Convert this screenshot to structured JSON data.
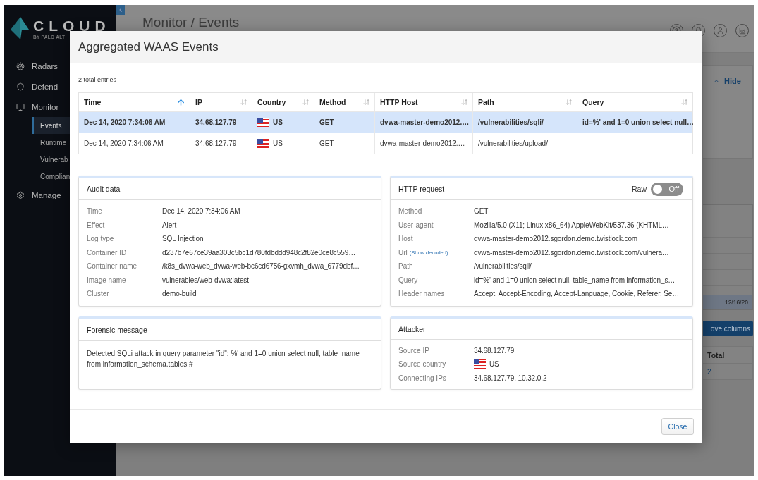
{
  "sidebar": {
    "logo": {
      "name": "CLOUD",
      "subtitle": "BY PALO ALT"
    },
    "items": [
      {
        "label": "Radars",
        "selected": false
      },
      {
        "label": "Defend",
        "selected": false
      },
      {
        "label": "Monitor",
        "selected": false,
        "children": [
          {
            "label": "Events",
            "selected": true
          },
          {
            "label": "Runtime",
            "selected": false
          },
          {
            "label": "Vulnerab",
            "selected": false
          },
          {
            "label": "Complian",
            "selected": false
          }
        ]
      },
      {
        "label": "Manage",
        "selected": false
      }
    ]
  },
  "header": {
    "title": "Monitor / Events"
  },
  "background": {
    "hide_label": "Hide",
    "date": "12/16/20",
    "button": "ove columns",
    "table_header": "Total",
    "table_value": "2"
  },
  "modal": {
    "title": "Aggregated WAAS Events",
    "count": "2 total entries",
    "table": {
      "columns": [
        {
          "label": "Time",
          "sorted": true
        },
        {
          "label": "IP",
          "sorted": false
        },
        {
          "label": "Country",
          "sorted": false
        },
        {
          "label": "Method",
          "sorted": false
        },
        {
          "label": "HTTP Host",
          "sorted": false
        },
        {
          "label": "Path",
          "sorted": false
        },
        {
          "label": "Query",
          "sorted": false
        }
      ],
      "rows": [
        {
          "selected": true,
          "time": "Dec 14, 2020 7:34:06 AM",
          "ip": "34.68.127.79",
          "country": "US",
          "method": "GET",
          "host": "dvwa-master-demo2012.…",
          "path": "/vulnerabilities/sqli/",
          "query": "id=%' and 1=0 union select null…"
        },
        {
          "selected": false,
          "time": "Dec 14, 2020 7:34:06 AM",
          "ip": "34.68.127.79",
          "country": "US",
          "method": "GET",
          "host": "dvwa-master-demo2012.…",
          "path": "/vulnerabilities/upload/"
        }
      ]
    },
    "audit": {
      "title": "Audit data",
      "fields": [
        {
          "label": "Time",
          "value": "Dec 14, 2020 7:34:06 AM"
        },
        {
          "label": "Effect",
          "value": "Alert"
        },
        {
          "label": "Log type",
          "value": "SQL Injection"
        },
        {
          "label": "Container ID",
          "value": "d237b7e67ce39aa303c5bc1d780fdbddd948c2f82e0ce8c559…"
        },
        {
          "label": "Container name",
          "value": "/k8s_dvwa-web_dvwa-web-bc6cd6756-gxvmh_dvwa_6779dbf…"
        },
        {
          "label": "Image name",
          "value": "vulnerables/web-dvwa:latest"
        },
        {
          "label": "Cluster",
          "value": "demo-build"
        }
      ]
    },
    "http": {
      "title": "HTTP request",
      "raw_label": "Raw",
      "toggle": {
        "on": false,
        "label": "Off"
      },
      "fields": [
        {
          "label": "Method",
          "value": "GET"
        },
        {
          "label": "User-agent",
          "value": "Mozilla/5.0 (X11; Linux x86_64) AppleWebKit/537.36 (KHTML…"
        },
        {
          "label": "Host",
          "value": "dvwa-master-demo2012.sgordon.demo.twistlock.com"
        },
        {
          "label": "Url",
          "hint": "(Show decoded)",
          "value": "dvwa-master-demo2012.sgordon.demo.twistlock.com/vulnera…"
        },
        {
          "label": "Path",
          "value": "/vulnerabilities/sqli/"
        },
        {
          "label": "Query",
          "value": "id=%' and 1=0 union select null, table_name from information_s…"
        },
        {
          "label": "Header names",
          "value": "Accept, Accept-Encoding, Accept-Language, Cookie, Referer, Se…"
        }
      ]
    },
    "forensic": {
      "title": "Forensic message",
      "message": "Detected SQLi attack in query parameter \"id\": %' and 1=0 union select null, table_name from information_schema.tables #"
    },
    "attacker": {
      "title": "Attacker",
      "fields": [
        {
          "kind": "text",
          "label": "Source IP",
          "value": "34.68.127.79"
        },
        {
          "kind": "country",
          "label": "Source country",
          "value": "US"
        },
        {
          "kind": "text",
          "label": "Connecting IPs",
          "value": "34.68.127.79, 10.32.0.2"
        }
      ]
    },
    "close": "Close"
  }
}
